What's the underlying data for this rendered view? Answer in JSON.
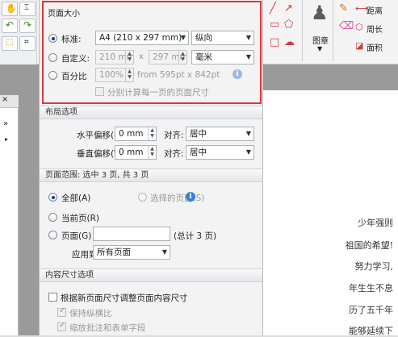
{
  "background": {
    "ribbon_labels": {
      "label1": "图章",
      "label2": "距离",
      "label3": "周长",
      "label4": "面积"
    },
    "document_lines": [
      "少年强则",
      "祖国的希望!",
      "努力学习,",
      "年生生不息",
      "历了五千年",
      "能够延续下"
    ]
  },
  "dialog": {
    "page_size": {
      "title": "页面大小",
      "standard": {
        "label": "标准:",
        "value": "A4 (210 x 297 mm)",
        "orientation": "纵向"
      },
      "custom": {
        "label": "自定义:",
        "width": "210 mm",
        "separator": "x",
        "height": "297 mm",
        "unit": "毫米"
      },
      "percent": {
        "label": "百分比",
        "value": "100%",
        "from_text": "from 595pt x 842pt"
      },
      "each_page_checkbox": "分别计算每一页的页面尺寸"
    },
    "layout": {
      "title": "布局选项",
      "h_offset_label": "水平偏移(H):",
      "h_offset_value": "0 mm",
      "v_offset_label": "垂直偏移(V):",
      "v_offset_value": "0 mm",
      "align_label": "对齐:",
      "h_align_value": "居中",
      "v_align_value": "居中"
    },
    "page_range": {
      "title": "页面范围: 选中 3 页, 共 3 页",
      "all_label": "全部(A)",
      "selected_label": "选择的页面(S)",
      "current_label": "当前页(R)",
      "pages_label": "页面(G)",
      "pages_value": "",
      "total_text": "(总计 3 页)",
      "apply_label": "应用到:",
      "apply_value": "所有页面"
    },
    "content": {
      "title": "内容尺寸选项",
      "resize_checkbox": "根据新页面尺寸调整页面内容尺寸",
      "keep_ratio_checkbox": "保持纵横比",
      "scale_annots_checkbox": "缩放批注和表单字段"
    }
  }
}
